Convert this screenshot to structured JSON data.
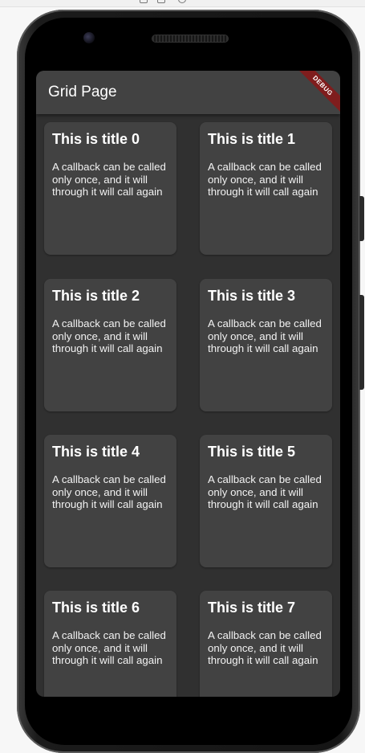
{
  "app_bar": {
    "title": "Grid Page",
    "debug_label": "DEBUG"
  },
  "colors": {
    "background": "#303030",
    "app_bar": "#424242",
    "card": "#424242",
    "debug_banner": "#7f1d1d",
    "text": "#ffffff"
  },
  "grid": {
    "items": [
      {
        "title": "This is title 0",
        "body": "A callback can be called only once, and it will through it will call again"
      },
      {
        "title": "This is title 1",
        "body": "A callback can be called only once, and it will through it will call again"
      },
      {
        "title": "This is title 2",
        "body": "A callback can be called only once, and it will through it will call again"
      },
      {
        "title": "This is title 3",
        "body": "A callback can be called only once, and it will through it will call again"
      },
      {
        "title": "This is title 4",
        "body": "A callback can be called only once, and it will through it will call again"
      },
      {
        "title": "This is title 5",
        "body": "A callback can be called only once, and it will through it will call again"
      },
      {
        "title": "This is title 6",
        "body": "A callback can be called only once, and it will through it will call again"
      },
      {
        "title": "This is title 7",
        "body": "A callback can be called only once, and it will through it will call again"
      }
    ]
  }
}
